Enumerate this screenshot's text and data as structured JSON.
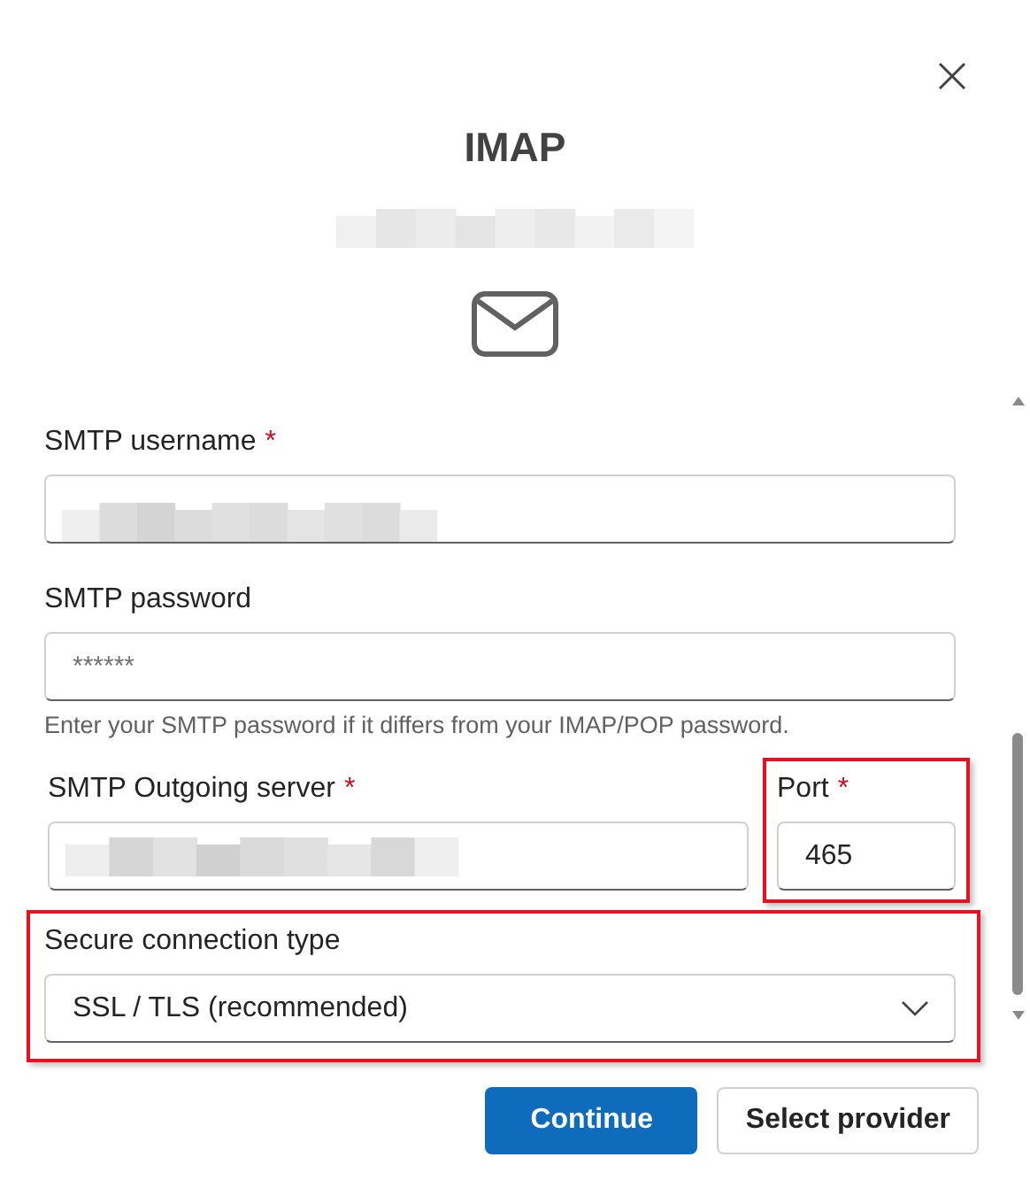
{
  "dialog": {
    "title": "IMAP",
    "subtitle_redacted": true
  },
  "username": {
    "label": "SMTP username",
    "required_mark": "*",
    "redacted": true
  },
  "password": {
    "label": "SMTP password",
    "placeholder": "******",
    "help": "Enter your SMTP password if it differs from your IMAP/POP password."
  },
  "server": {
    "label": "SMTP Outgoing server",
    "required_mark": "*",
    "redacted": true
  },
  "port": {
    "label": "Port",
    "required_mark": "*",
    "value": "465",
    "highlighted": true
  },
  "connection": {
    "label": "Secure connection type",
    "value": "SSL / TLS (recommended)",
    "highlighted": true
  },
  "buttons": [
    {
      "label": "Continue",
      "primary": true
    },
    {
      "label": "Select provider",
      "primary": false
    }
  ]
}
